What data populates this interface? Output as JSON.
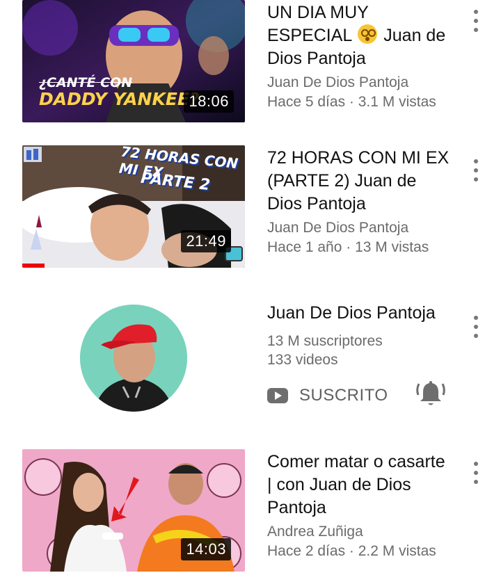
{
  "videos": [
    {
      "title": "UN DIA MUY ESPECIAL",
      "title_suffix": "Juan de Dios Pantoja",
      "channel": "Juan De Dios Pantoja",
      "stats": "Hace 5 días · 3.1 M vistas",
      "duration": "18:06",
      "thumb_text_1": "¿CANTÉ CON",
      "thumb_text_2": "DADDY YANKEE?"
    },
    {
      "title": "72 HORAS CON MI EX (PARTE 2) Juan de Dios Pantoja",
      "channel": "Juan De Dios Pantoja",
      "stats": "Hace 1 año · 13 M vistas",
      "duration": "21:49",
      "thumb_text_1": "72 HORAS CON MI EX",
      "thumb_text_2": "PARTE 2",
      "watched_fraction": 0.1
    },
    {
      "title": "Comer matar o casarte | con Juan de Dios Pantoja",
      "channel": "Andrea Zuñiga",
      "stats": "Hace 2 días · 2.2 M vistas",
      "duration": "14:03"
    }
  ],
  "channel_card": {
    "name": "Juan De Dios Pantoja",
    "subscribers": "13 M suscriptores",
    "videos": "133 videos",
    "subscribe_label": "SUSCRITO"
  },
  "icons": {
    "menu": "more-vert-icon",
    "subscribe": "youtube-play-icon",
    "notifications": "bell-ringing-icon"
  },
  "colors": {
    "title": "#111111",
    "meta": "#6b6b6b",
    "progress": "#ee0000",
    "duration_bg": "#000000"
  }
}
